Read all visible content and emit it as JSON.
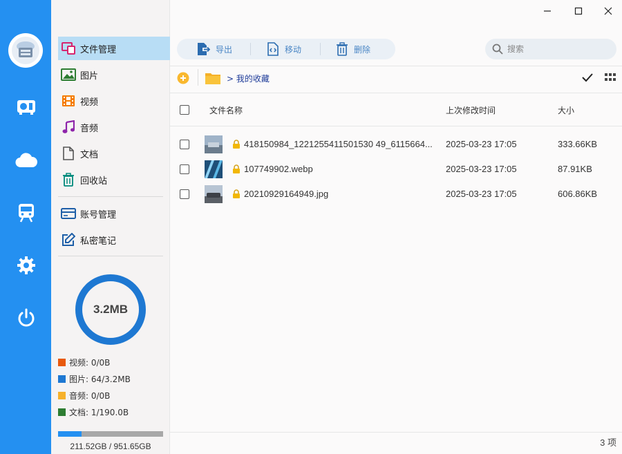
{
  "sidebar": {
    "items": [
      {
        "label": "文件管理",
        "icon": "file-manager-icon"
      },
      {
        "label": "图片",
        "icon": "image-icon"
      },
      {
        "label": "视频",
        "icon": "video-icon"
      },
      {
        "label": "音频",
        "icon": "music-icon"
      },
      {
        "label": "文档",
        "icon": "document-icon"
      },
      {
        "label": "回收站",
        "icon": "trash-icon"
      },
      {
        "label": "账号管理",
        "icon": "card-icon"
      },
      {
        "label": "私密笔记",
        "icon": "note-edit-icon"
      }
    ],
    "usage_total": "3.2MB",
    "usage_legend": [
      {
        "label": "视频: 0/0B",
        "color": "#e8590c"
      },
      {
        "label": "图片: 64/3.2MB",
        "color": "#1e78d2"
      },
      {
        "label": "音频: 0/0B",
        "color": "#f6b12b"
      },
      {
        "label": "文档: 1/190.0B",
        "color": "#2e7d32"
      }
    ],
    "storage_text": "211.52GB / 951.65GB",
    "storage_fraction": 0.222
  },
  "rail": {
    "icons": [
      "app-logo-icon",
      "radio-icon",
      "cloud-icon",
      "train-icon",
      "gear-icon",
      "power-icon"
    ]
  },
  "toolbar": {
    "export_label": "导出",
    "move_label": "移动",
    "delete_label": "删除"
  },
  "search": {
    "placeholder": "搜索",
    "value": ""
  },
  "path": {
    "breadcrumb": "> 我的收藏"
  },
  "table": {
    "columns": [
      "文件名称",
      "上次修改时间",
      "大小"
    ],
    "rows": [
      {
        "name": "418150984_1221255411501530 49_6115664...",
        "time": "2025-03-23 17:05",
        "size": "333.66KB"
      },
      {
        "name": "107749902.webp",
        "time": "2025-03-23 17:05",
        "size": "87.91KB"
      },
      {
        "name": "20210929164949.jpg",
        "time": "2025-03-23 17:05",
        "size": "606.86KB"
      }
    ]
  },
  "status": {
    "count": "3 项"
  },
  "colors": {
    "accent": "#2490f1",
    "active_bg": "#b8ddf5"
  }
}
